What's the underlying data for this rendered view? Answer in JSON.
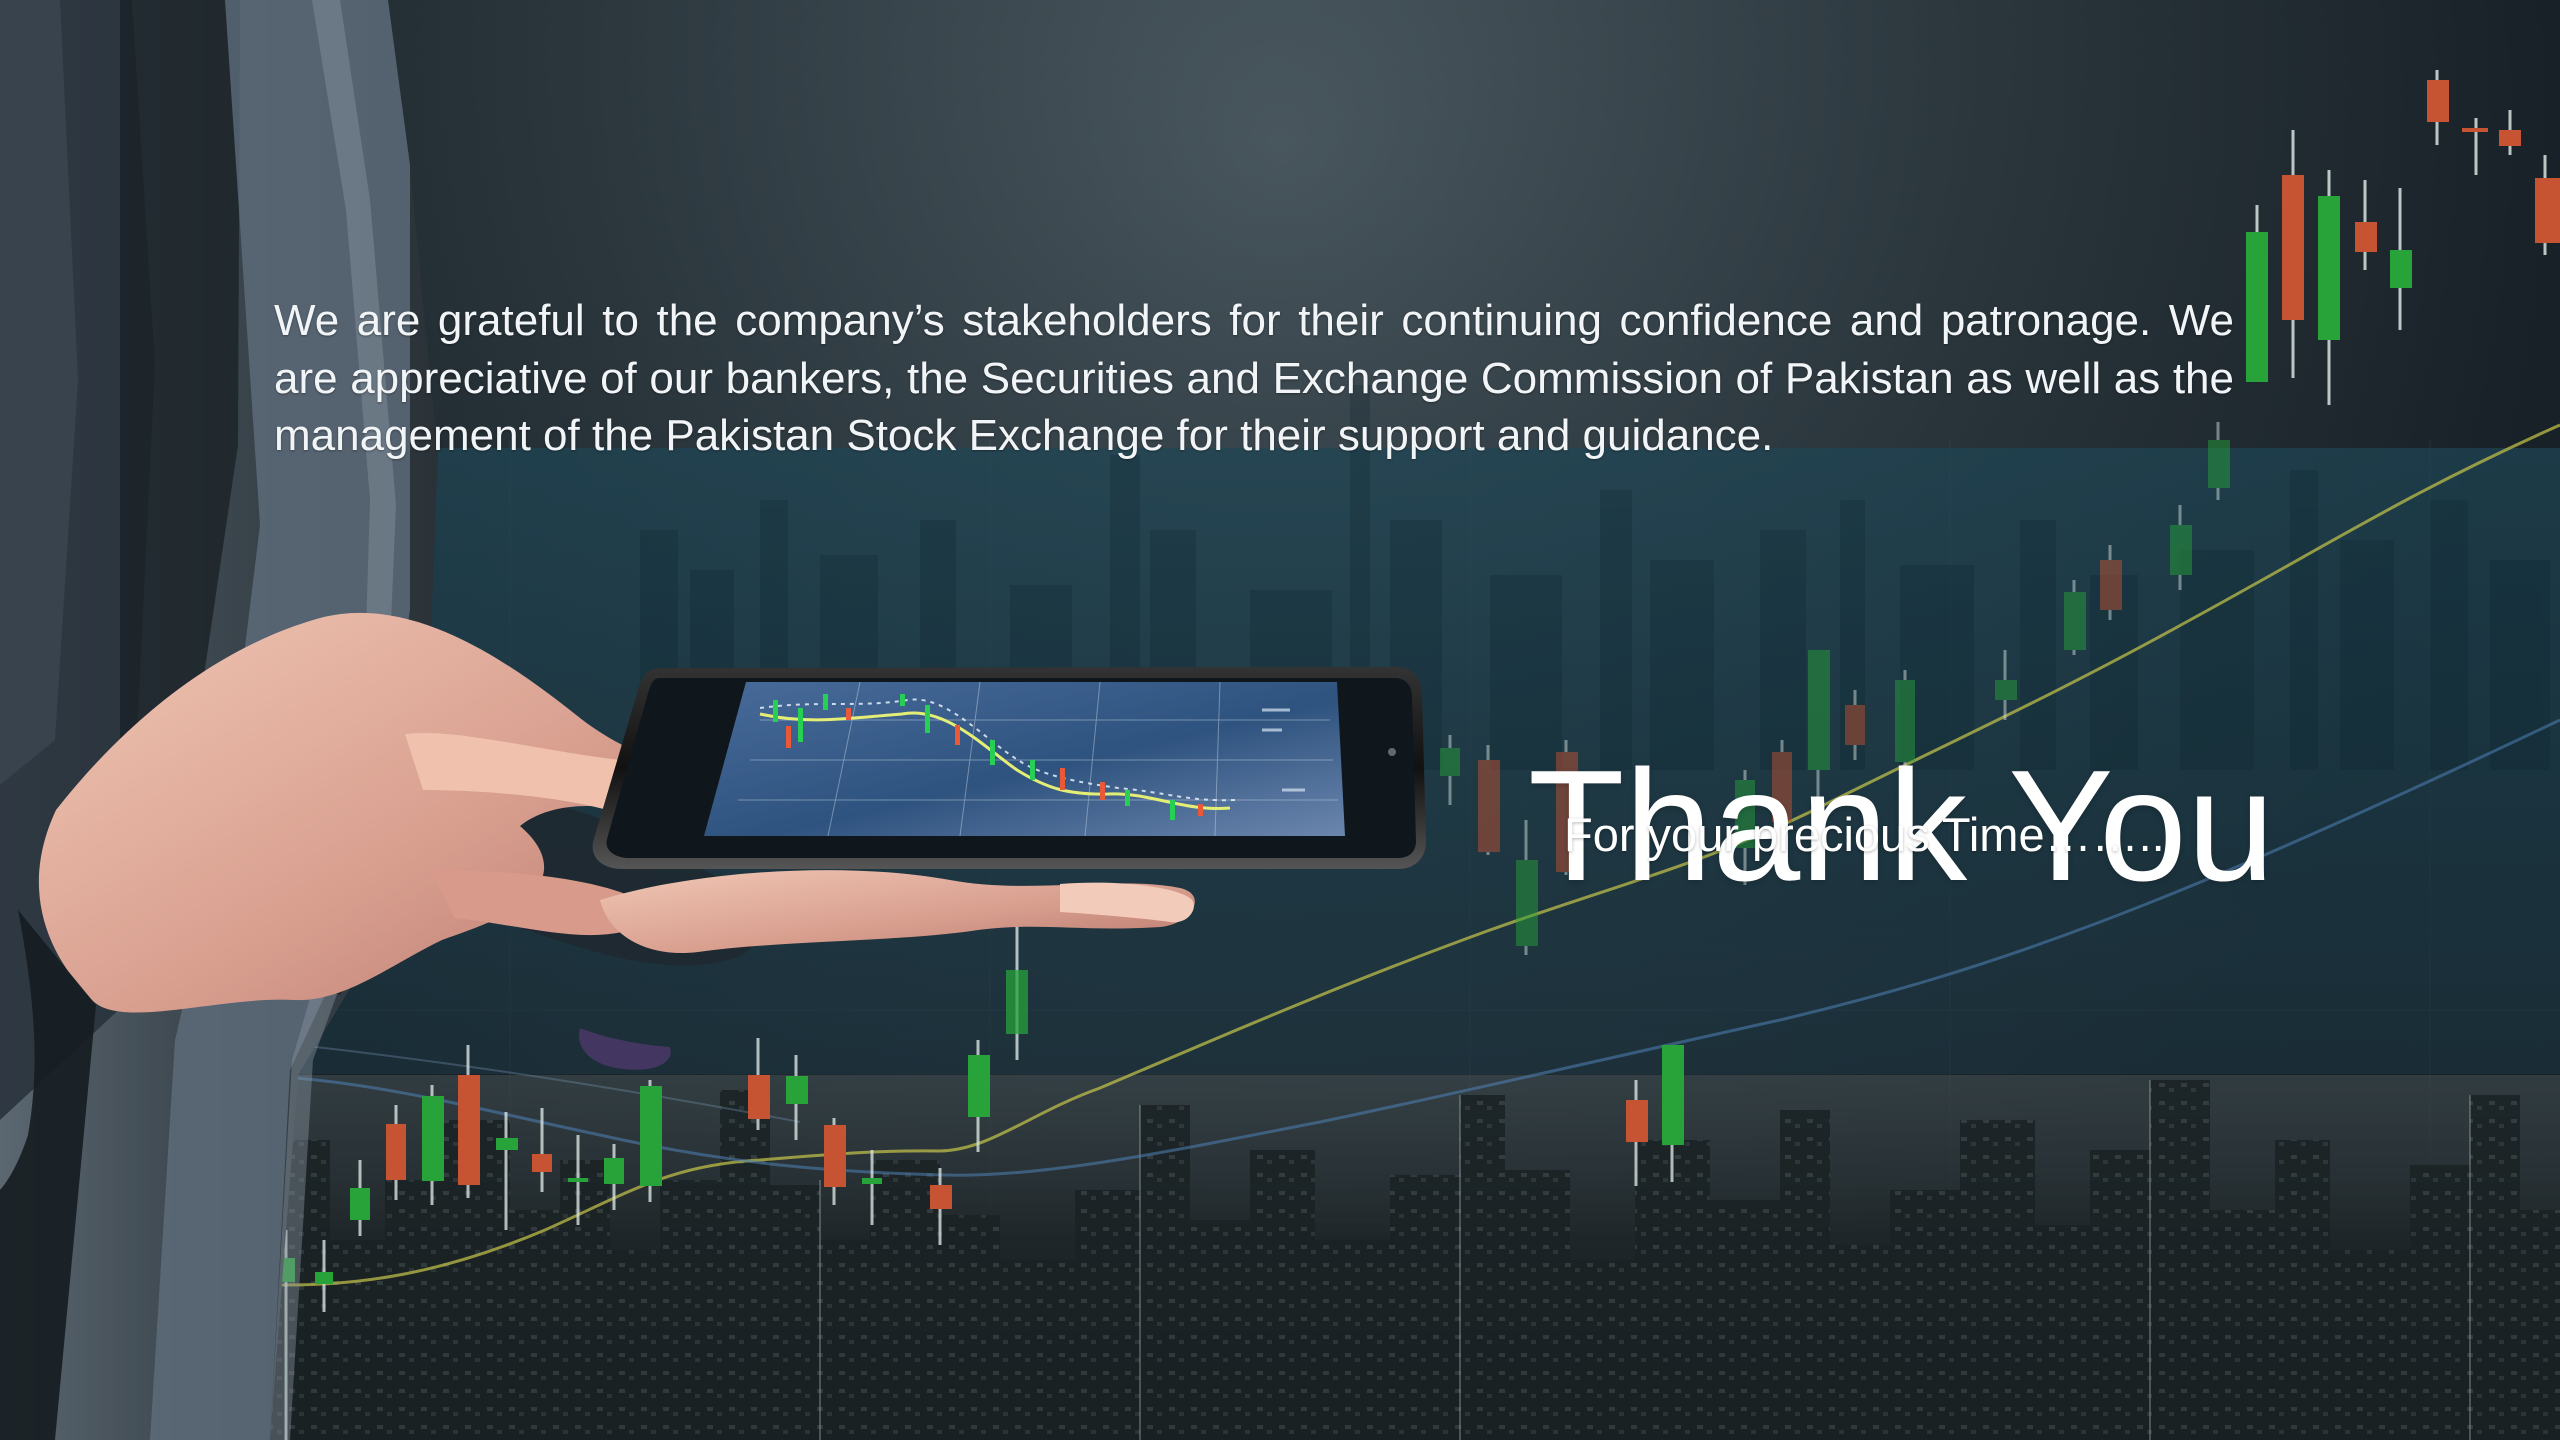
{
  "slide": {
    "body_text": "We are grateful to the company’s stakeholders for their continuing confidence and patronage. We are appreciative of our bankers, the Securities and Exchange Commission of Pakistan as well as the management of the Pakistan Stock Exchange for their support and guidance.",
    "title": "Thank You",
    "subtitle": "For your precious Time…….."
  },
  "colors": {
    "background_dark": "#1f2a30",
    "panel_teal": "#1e3341",
    "candle_green": "#27a33a",
    "candle_red": "#c65432",
    "text_white": "#ffffff"
  },
  "icons": {
    "background": "stock-market-city-photo",
    "tablet": "tablet-stock-chart-illustration"
  }
}
